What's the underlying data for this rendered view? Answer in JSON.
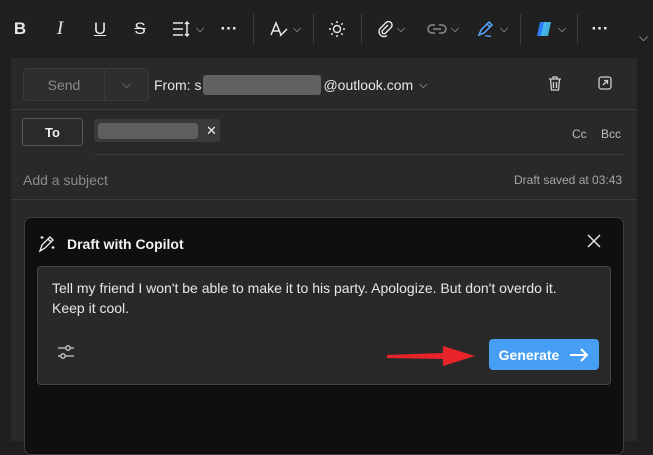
{
  "toolbar": {
    "items": [
      {
        "name": "bold",
        "glyph": "B"
      },
      {
        "name": "italic",
        "glyph": "I"
      },
      {
        "name": "underline",
        "glyph": "U"
      },
      {
        "name": "strikethrough",
        "glyph": "S"
      }
    ],
    "more_glyph": "···"
  },
  "compose": {
    "send_label": "Send",
    "from_prefix": "From: s",
    "from_domain": "@outlook.com",
    "to_label": "To",
    "cc_label": "Cc",
    "bcc_label": "Bcc",
    "subject_placeholder": "Add a subject",
    "draft_status": "Draft saved at 03:43"
  },
  "copilot": {
    "title": "Draft with Copilot",
    "prompt": "Tell my friend I won't be able to make it to his party. Apologize. But don't overdo it. Keep it cool.",
    "generate_label": "Generate"
  },
  "colors": {
    "accent": "#479ef5",
    "annotation_arrow": "#e8232a",
    "background": "#1f1f1f",
    "panel": "#0f0f0f"
  }
}
